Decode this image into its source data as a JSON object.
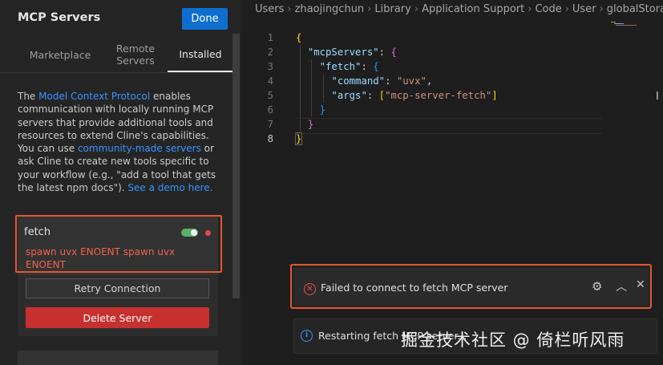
{
  "panel": {
    "title": "MCP Servers",
    "done_label": "Done",
    "tabs": [
      {
        "label": "Marketplace"
      },
      {
        "label": "Remote Servers"
      },
      {
        "label": "Installed"
      }
    ],
    "description": {
      "p1": "The ",
      "link1": "Model Context Protocol",
      "p2": " enables communication with locally running MCP servers that provide additional tools and resources to extend Cline's capabilities. You can use ",
      "link2": "community-made servers",
      "p3": " or ask Cline to create new tools specific to your workflow (e.g., \"add a tool that gets the latest npm docs\"). ",
      "link3": "See a demo here."
    },
    "server": {
      "name": "fetch",
      "enabled": true,
      "status_color": "#e04b4b",
      "error": "spawn uvx ENOENT spawn uvx ENOENT",
      "retry_label": "Retry Connection",
      "delete_label": "Delete Server"
    }
  },
  "editor": {
    "breadcrumb": [
      "Users",
      "zhaojingchun",
      "Library",
      "Application Support",
      "Code",
      "User",
      "globalStorag"
    ],
    "current_line": 8,
    "lines": [
      {
        "no": "1",
        "tokens": [
          {
            "t": "{",
            "c": "brace-y"
          }
        ]
      },
      {
        "no": "2",
        "tokens": [
          {
            "t": "  ",
            "c": "punct"
          },
          {
            "t": "\"mcpServers\"",
            "c": "key"
          },
          {
            "t": ": ",
            "c": "punct"
          },
          {
            "t": "{",
            "c": "brace-p"
          }
        ]
      },
      {
        "no": "3",
        "tokens": [
          {
            "t": "    ",
            "c": "punct"
          },
          {
            "t": "\"fetch\"",
            "c": "key"
          },
          {
            "t": ": ",
            "c": "punct"
          },
          {
            "t": "{",
            "c": "brace-b"
          }
        ]
      },
      {
        "no": "4",
        "tokens": [
          {
            "t": "      ",
            "c": "punct"
          },
          {
            "t": "\"command\"",
            "c": "key"
          },
          {
            "t": ": ",
            "c": "punct"
          },
          {
            "t": "\"uvx\"",
            "c": "str"
          },
          {
            "t": ",",
            "c": "punct"
          }
        ]
      },
      {
        "no": "5",
        "tokens": [
          {
            "t": "      ",
            "c": "punct"
          },
          {
            "t": "\"args\"",
            "c": "key"
          },
          {
            "t": ": ",
            "c": "punct"
          },
          {
            "t": "[",
            "c": "brace-y"
          },
          {
            "t": "\"mcp-server-fetch\"",
            "c": "str"
          },
          {
            "t": "]",
            "c": "brace-y"
          }
        ]
      },
      {
        "no": "6",
        "tokens": [
          {
            "t": "    ",
            "c": "punct"
          },
          {
            "t": "}",
            "c": "brace-b"
          }
        ]
      },
      {
        "no": "7",
        "tokens": [
          {
            "t": "  ",
            "c": "punct"
          },
          {
            "t": "}",
            "c": "brace-p"
          }
        ]
      },
      {
        "no": "8",
        "tokens": [
          {
            "t": "}",
            "c": "brace-y bm"
          }
        ]
      }
    ]
  },
  "notifications": {
    "error_message": "Failed to connect to fetch MCP server",
    "info_message": "Restarting fetch MCP server..."
  },
  "watermark": "掘金技术社区 @ 倚栏听风雨",
  "colors": {
    "accent": "#0e6fd0",
    "danger": "#c6302e",
    "error_text": "#f1624f",
    "toggle_on": "#59b068",
    "highlight_box": "#e4572e"
  }
}
